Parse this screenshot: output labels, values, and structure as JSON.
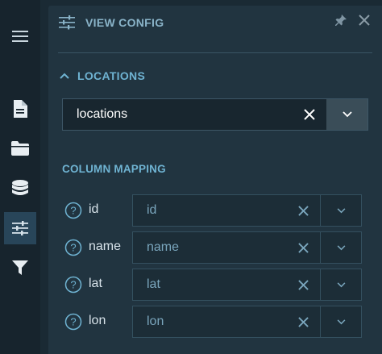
{
  "sidebar": {
    "items": [
      {
        "icon": "menu-icon"
      },
      {
        "icon": "document-icon"
      },
      {
        "icon": "folder-icon"
      },
      {
        "icon": "database-icon"
      },
      {
        "icon": "sliders-icon",
        "active": true
      },
      {
        "icon": "filter-icon"
      }
    ]
  },
  "panel": {
    "title": "VIEW CONFIG",
    "section_title": "LOCATIONS",
    "dataset_value": "locations",
    "column_mapping_title": "COLUMN MAPPING",
    "mappings": [
      {
        "name": "id",
        "value": "id"
      },
      {
        "name": "name",
        "value": "name"
      },
      {
        "name": "lat",
        "value": "lat"
      },
      {
        "name": "lon",
        "value": "lon"
      }
    ]
  },
  "colors": {
    "accent": "#6fb3d2",
    "panel_bg": "#213440",
    "sidebar_bg": "#17242d",
    "active_item": "#284559"
  }
}
